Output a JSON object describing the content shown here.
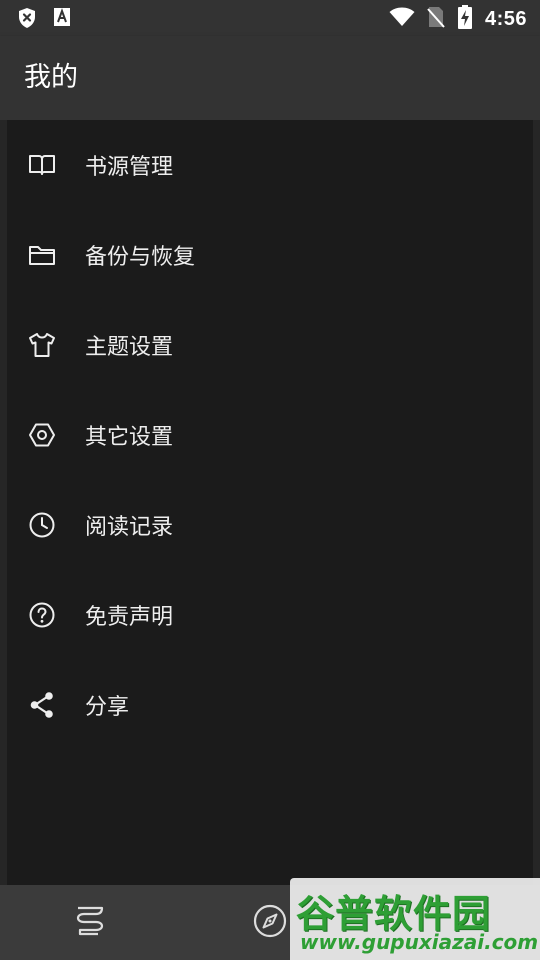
{
  "status_bar": {
    "time": "4:56"
  },
  "app_bar": {
    "title": "我的"
  },
  "menu": {
    "items": [
      {
        "label": "书源管理",
        "icon": "book-open-icon"
      },
      {
        "label": "备份与恢复",
        "icon": "folder-icon"
      },
      {
        "label": "主题设置",
        "icon": "tshirt-icon"
      },
      {
        "label": "其它设置",
        "icon": "hexagon-settings-icon"
      },
      {
        "label": "阅读记录",
        "icon": "clock-icon"
      },
      {
        "label": "免责声明",
        "icon": "help-circle-icon"
      },
      {
        "label": "分享",
        "icon": "share-icon"
      }
    ]
  },
  "bottom_nav": {
    "items": [
      {
        "icon": "bookshelf-icon"
      },
      {
        "icon": "compass-icon"
      }
    ]
  },
  "watermark": {
    "brand": "谷普软件园",
    "url": "www.gupuxiazai.com"
  },
  "colors": {
    "bar": "#333333",
    "background": "#1b1b1b",
    "text": "#eeeeee",
    "watermark_green": "#2e9f35"
  }
}
